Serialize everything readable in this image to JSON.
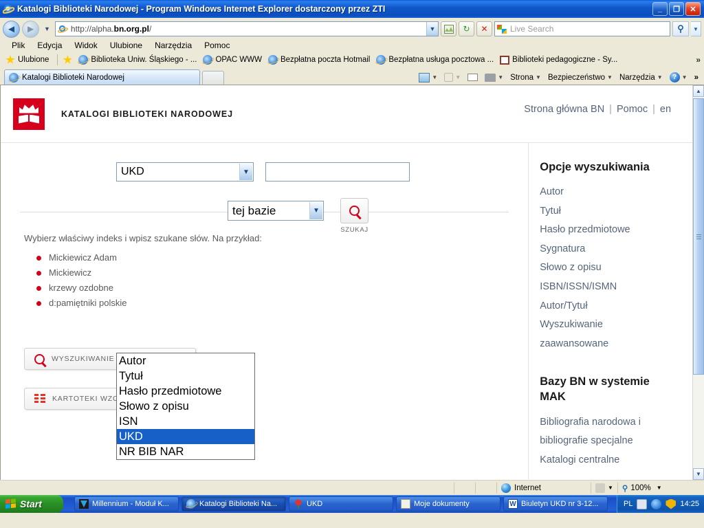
{
  "window": {
    "title": "Katalogi Biblioteki Narodowej - Program Windows Internet Explorer dostarczony przez ZTI",
    "minimize_label": "_",
    "restore_label": "❐",
    "close_label": "✕"
  },
  "nav": {
    "back_label": "◄",
    "forward_label": "►",
    "history_caret": "▼",
    "url": "http://alpha.",
    "url_bold": "bn.org.pl",
    "url_tail": "/",
    "address_caret": "▼",
    "compat_icon": "compatibility-view-icon",
    "refresh_label": "↻",
    "stop_label": "✕",
    "search_placeholder": "Live Search",
    "search_go": "⚲",
    "search_caret": "▼"
  },
  "menubar": {
    "items": [
      "Plik",
      "Edycja",
      "Widok",
      "Ulubione",
      "Narzędzia",
      "Pomoc"
    ]
  },
  "favbar": {
    "favorites_label": "Ulubione",
    "items": [
      {
        "label": "Biblioteka Uniw. Śląskiego - ...",
        "icon": "ie-icon"
      },
      {
        "label": "OPAC WWW",
        "icon": "ie-icon"
      },
      {
        "label": "Bezpłatna poczta Hotmail",
        "icon": "ie-icon"
      },
      {
        "label": "Bezpłatna usługa pocztowa ...",
        "icon": "ie-icon"
      },
      {
        "label": "Biblioteki pedagogiczne - Sy...",
        "icon": "book-icon"
      }
    ],
    "overflow": "»"
  },
  "tabs": {
    "items": [
      {
        "label": "Katalogi Biblioteki Narodowej"
      }
    ],
    "new_tab_label": ""
  },
  "commandbar": {
    "home": "",
    "feeds": "",
    "mail": "",
    "print": "",
    "items": [
      "Strona",
      "Bezpieczeństwo",
      "Narzędzia"
    ],
    "help": "?",
    "overflow": "»",
    "caret": "▼"
  },
  "page": {
    "brand": "KATALOGI BIBLIOTEKI NARODOWEJ",
    "toplinks": [
      {
        "label": "Strona główna BN"
      },
      {
        "label": "Pomoc"
      },
      {
        "label": "en"
      }
    ],
    "separator": "|",
    "search": {
      "index_selected": "UKD",
      "index_caret": "▼",
      "query_value": "",
      "base_selected": "tej bazie",
      "base_caret": "▼",
      "submit_label": "SZUKAJ"
    },
    "dropdown": {
      "open": true,
      "options": [
        {
          "label": "Autor",
          "selected": false
        },
        {
          "label": "Tytuł",
          "selected": false
        },
        {
          "label": "Hasło przedmiotowe",
          "selected": false
        },
        {
          "label": "Słowo z opisu",
          "selected": false
        },
        {
          "label": "ISN",
          "selected": false
        },
        {
          "label": "UKD",
          "selected": true
        },
        {
          "label": "NR BIB NAR",
          "selected": false
        }
      ]
    },
    "hint": "Wybierz właściwy indeks i wpisz szukane słów. Na przykład:",
    "examples": [
      "Mickiewicz Adam",
      "Mickiewicz",
      "krzewy ozdobne",
      "d:pamiętniki polskie"
    ],
    "buttons": {
      "advanced": "WYSZUKIWANIE ZAAWANSOWANE",
      "authority": "KARTOTEKI WZORCOWE"
    },
    "sidebar": {
      "heading1": "Opcje wyszukiwania",
      "links1": [
        "Autor",
        "Tytuł",
        "Hasło przedmiotowe",
        "Sygnatura",
        "Słowo z opisu",
        "ISBN/ISSN/ISMN",
        "Autor/Tytuł",
        "Wyszukiwanie zaawansowane"
      ],
      "heading2": "Bazy BN w systemie MAK",
      "links2": [
        "Bibliografia narodowa i bibliografie specjalne",
        "Katalogi centralne"
      ]
    }
  },
  "statusbar": {
    "zone": "Internet",
    "zoom": "100%",
    "zoom_caret": "▼",
    "protect_caret": "▼"
  },
  "taskbar": {
    "start": "Start",
    "items": [
      {
        "label": "Millennium - Moduł K...",
        "icon": "tv-icon",
        "active": false
      },
      {
        "label": "Katalogi Biblioteki Na...",
        "icon": "ie-icon",
        "active": true
      },
      {
        "label": "UKD",
        "icon": "rose-icon",
        "active": false
      },
      {
        "label": "Moje dokumenty",
        "icon": "folder-icon",
        "active": false
      },
      {
        "label": "Biuletyn UKD nr 3-12...",
        "icon": "word-icon",
        "active": false
      }
    ],
    "language": "PL",
    "clock": "14:25"
  },
  "colors": {
    "brand_red": "#d6001c",
    "accent_blue": "#1660c8",
    "titlebar_blue": "#1157c9",
    "bullet_red": "#d0021b"
  }
}
